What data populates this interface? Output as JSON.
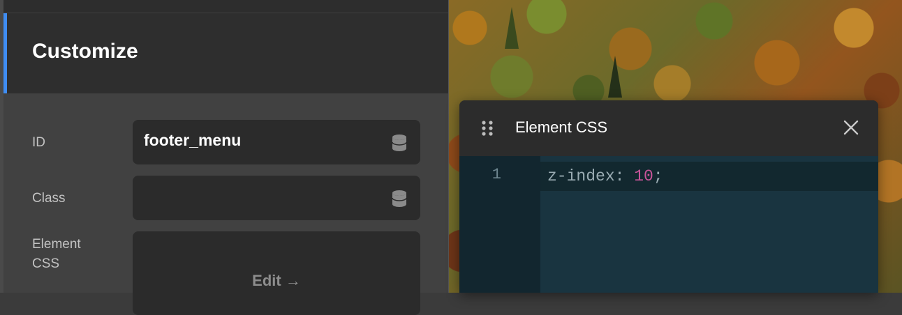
{
  "customize": {
    "title": "Customize"
  },
  "fields": {
    "id": {
      "label": "ID",
      "value": "footer_menu",
      "icon": "database-icon"
    },
    "class": {
      "label": "Class",
      "value": "",
      "icon": "database-icon"
    },
    "element_css": {
      "label_line1": "Element",
      "label_line2": "CSS",
      "edit_label": "Edit →"
    }
  },
  "css_panel": {
    "title": "Element CSS",
    "line_number": "1",
    "code_property": "z-index: ",
    "code_value": "10",
    "code_end": ";"
  },
  "colors": {
    "accent": "#3f8df3",
    "panel_bg": "#414141",
    "editor_bg": "#193440",
    "code_number": "#c9559a"
  }
}
